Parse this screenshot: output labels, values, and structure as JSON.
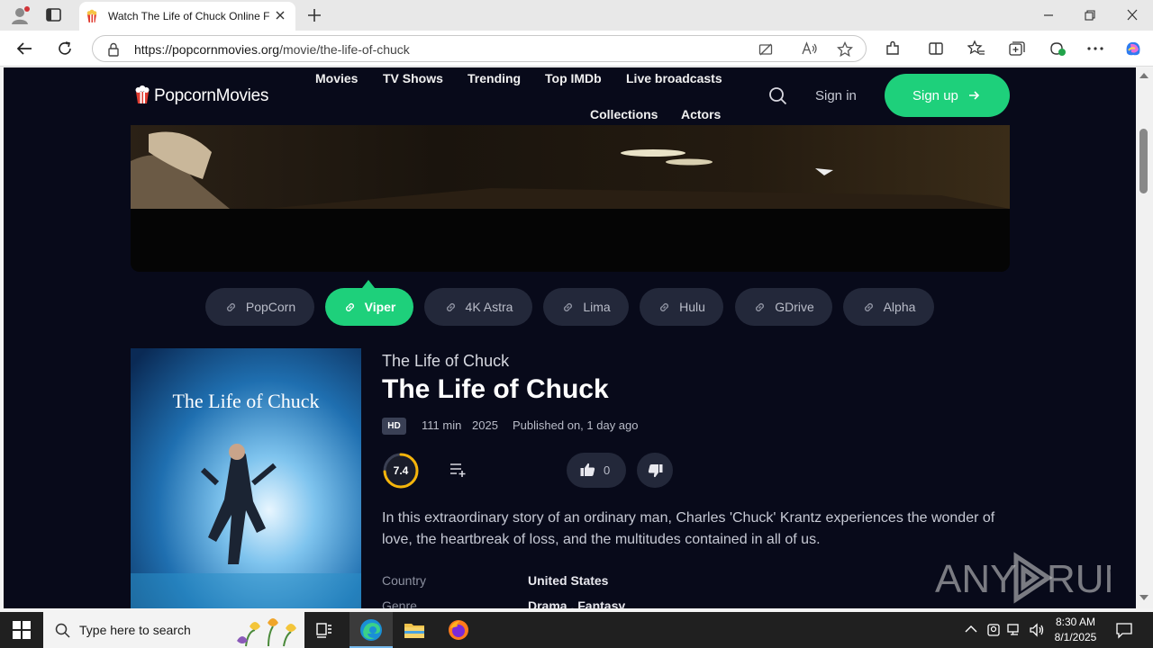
{
  "browser": {
    "tab_title": "Watch The Life of Chuck Online F",
    "url_domain": "https://popcornmovies.org",
    "url_path": "/movie/the-life-of-chuck"
  },
  "site": {
    "logo": "PopcornMovies",
    "nav": [
      "Movies",
      "TV Shows",
      "Trending",
      "Top IMDb",
      "Live broadcasts",
      "Collections",
      "Actors"
    ],
    "sign_in": "Sign in",
    "sign_up": "Sign up"
  },
  "servers": [
    {
      "label": "PopCorn",
      "active": false
    },
    {
      "label": "Viper",
      "active": true
    },
    {
      "label": "4K Astra",
      "active": false
    },
    {
      "label": "Lima",
      "active": false
    },
    {
      "label": "Hulu",
      "active": false
    },
    {
      "label": "GDrive",
      "active": false
    },
    {
      "label": "Alpha",
      "active": false
    }
  ],
  "movie": {
    "poster_title": "The Life of Chuck",
    "original_title": "The Life of Chuck",
    "title": "The Life of Chuck",
    "quality": "HD",
    "runtime": "111 min",
    "year": "2025",
    "published": "Published on, 1 day ago",
    "rating": "7.4",
    "rating_fraction": 0.74,
    "likes": "0",
    "description": "In this extraordinary story of an ordinary man, Charles 'Chuck' Krantz experiences the wonder of love, the heartbreak of loss, and the multitudes contained in all of us.",
    "info": [
      {
        "label": "Country",
        "value": "United States"
      },
      {
        "label": "Genre",
        "value": "Drama , Fantasy"
      }
    ]
  },
  "watermark": "ANY RUN",
  "taskbar": {
    "search_placeholder": "Type here to search",
    "time": "8:30 AM",
    "date": "8/1/2025"
  },
  "colors": {
    "accent": "#1ed07b",
    "page_bg": "#080a1a",
    "chip_bg": "#23283a",
    "rating_ring": "#f5b50a"
  }
}
